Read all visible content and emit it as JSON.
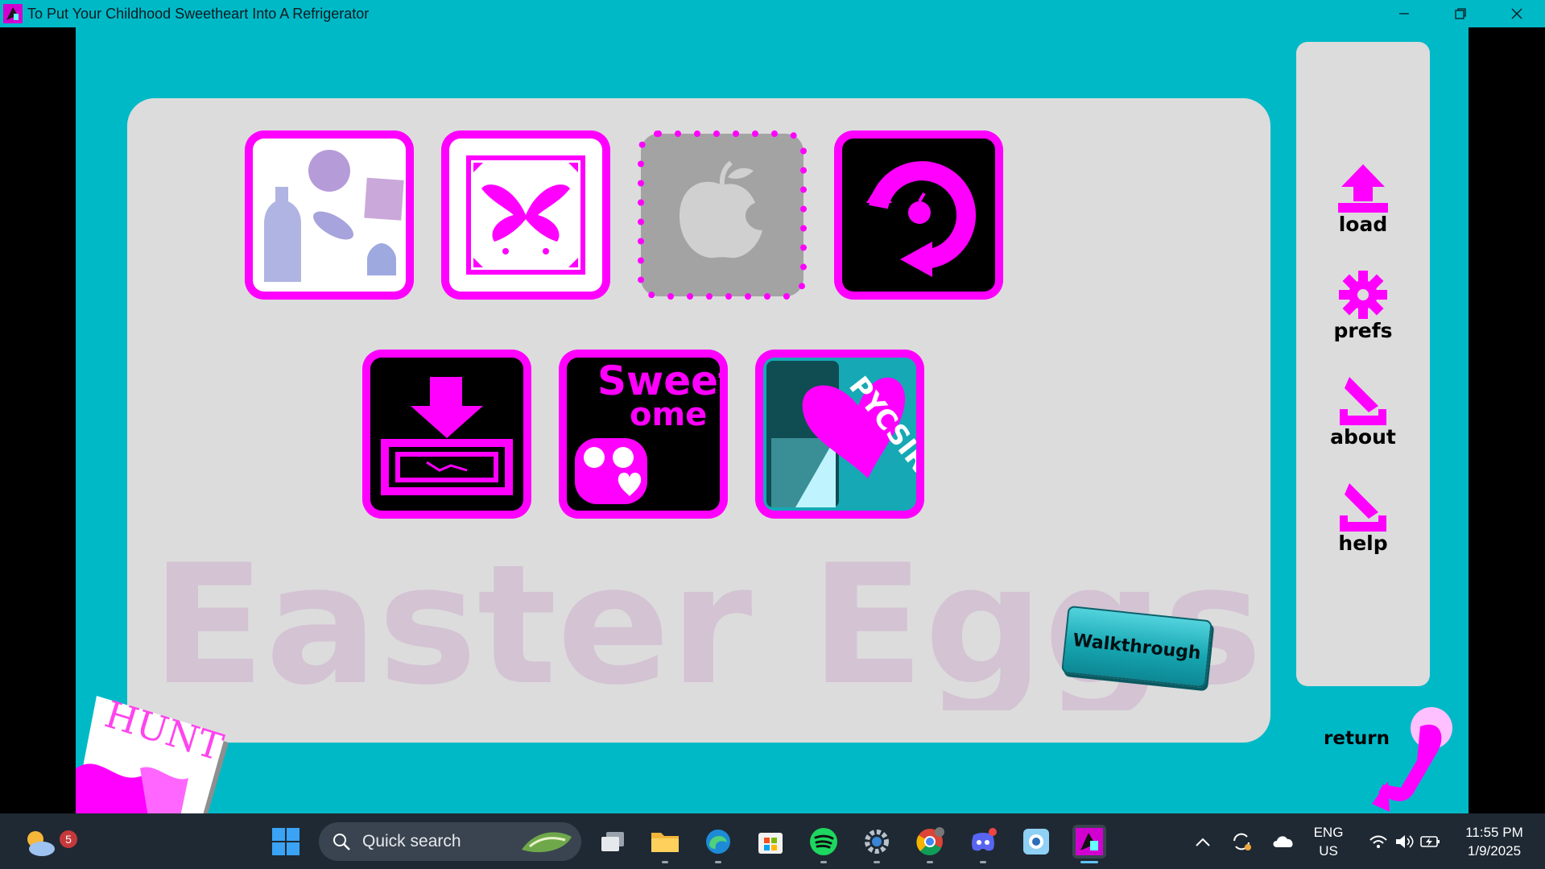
{
  "window": {
    "title": "To Put Your Childhood Sweetheart Into A Refrigerator",
    "controls": [
      "minimize",
      "restore",
      "close"
    ]
  },
  "main": {
    "watermark_text": "Easter Eggs",
    "tiles": [
      {
        "id": "collage",
        "icon": "collage-icon"
      },
      {
        "id": "inkblot",
        "icon": "butterfly-inkblot-icon"
      },
      {
        "id": "apple-locked",
        "icon": "apple-icon",
        "locked": true
      },
      {
        "id": "restart",
        "icon": "circular-arrow-apple-icon"
      },
      {
        "id": "download",
        "icon": "download-tray-icon"
      },
      {
        "id": "sweet-some",
        "label_line1": "Sweet",
        "label_line2": "ome",
        "icon": "sweet-some-logo"
      },
      {
        "id": "pycsir",
        "label": "PYCSIR",
        "icon": "pycsir-heart-logo"
      }
    ],
    "walkthrough_label": "Walkthrough",
    "hunt_label": "HUNT"
  },
  "sidebar": {
    "items": [
      {
        "label": "load",
        "icon": "upload-arrow-icon"
      },
      {
        "label": "prefs",
        "icon": "gear-icon"
      },
      {
        "label": "about",
        "icon": "pen-tray-icon"
      },
      {
        "label": "help",
        "icon": "pen-tray-icon"
      }
    ]
  },
  "return_label": "return",
  "taskbar": {
    "weather_badge": "5",
    "search_placeholder": "Quick search",
    "language_line1": "ENG",
    "language_line2": "US",
    "time": "11:55 PM",
    "date": "1/9/2025"
  },
  "colors": {
    "accent": "#ff00ff",
    "background": "#00b9c7",
    "panel": "#dcdcdc",
    "taskbar": "#1f2933"
  }
}
